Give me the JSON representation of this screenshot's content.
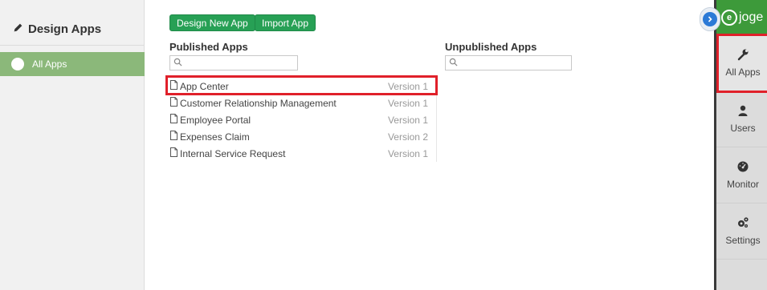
{
  "sidebar": {
    "title": "Design Apps",
    "items": [
      {
        "label": "All Apps"
      }
    ]
  },
  "toolbar": {
    "design_label": "Design New App",
    "import_label": "Import App"
  },
  "published": {
    "title": "Published Apps",
    "apps": [
      {
        "name": "App Center",
        "version": "Version 1"
      },
      {
        "name": "Customer Relationship Management",
        "version": "Version 1"
      },
      {
        "name": "Employee Portal",
        "version": "Version 1"
      },
      {
        "name": "Expenses Claim",
        "version": "Version 2"
      },
      {
        "name": "Internal Service Request",
        "version": "Version 1"
      }
    ]
  },
  "unpublished": {
    "title": "Unpublished Apps"
  },
  "right_panel": {
    "logo_text": "joge",
    "nav": [
      {
        "label": "All Apps",
        "icon": "wrench-icon"
      },
      {
        "label": "Users",
        "icon": "user-icon"
      },
      {
        "label": "Monitor",
        "icon": "dashboard-icon"
      },
      {
        "label": "Settings",
        "icon": "gears-icon"
      }
    ]
  },
  "colors": {
    "accent_green": "#27a055",
    "sidebar_active": "#8bb87a",
    "highlight_red": "#e0202a"
  }
}
